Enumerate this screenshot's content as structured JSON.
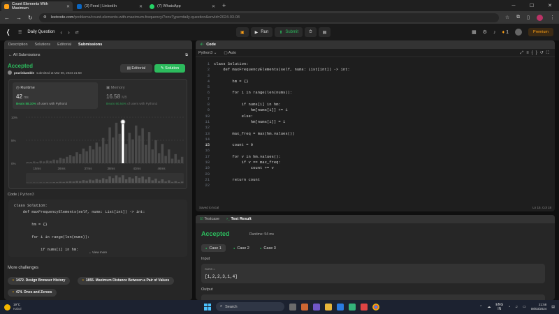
{
  "browser": {
    "tabs": [
      {
        "title": "Count Elements With Maximum",
        "active": true,
        "fav_color": "#ffa116"
      },
      {
        "title": "(3) Feed | LinkedIn",
        "active": false,
        "fav_color": "#0a66c2"
      },
      {
        "title": "(7) WhatsApp",
        "active": false,
        "fav_color": "#25d366"
      }
    ],
    "new_tab": "+",
    "url_host": "leetcode.com",
    "url_path": "/problems/count-elements-with-maximum-frequency/?envType=daily-question&envId=2024-03-08"
  },
  "lc_nav": {
    "daily_label": "Daily Question",
    "run_label": "Run",
    "submit_label": "Submit",
    "streak": "1",
    "premium_label": "Premium"
  },
  "left": {
    "tabs": [
      "Description",
      "Solutions",
      "Editorial",
      "Submissions"
    ],
    "active_tab": "Submissions",
    "back_label": "All Submissions",
    "status": "Accepted",
    "submitter": "pravinkamble",
    "submitted_at": "submitted at Mar 08, 2024 21:58",
    "editorial_btn": "Editorial",
    "solution_btn": "Solution",
    "runtime": {
      "title": "Runtime",
      "value": "42",
      "unit": "ms",
      "beats_label": "Beats",
      "beats_pct": "88.10%",
      "beats_suffix": "of users with Python3"
    },
    "memory": {
      "title": "Memory",
      "value": "16.58",
      "unit": "MB",
      "beats_label": "Beats",
      "beats_pct": "60.54%",
      "beats_suffix": "of users with Python3"
    },
    "code_label": "Code",
    "code_lang": "Python3",
    "code_preview": [
      "class Solution:",
      "    def maxFrequencyElements(self, nums: List[int]) -> int:",
      "",
      "        hm = {}",
      "",
      "        for i in range(len(nums)):",
      "",
      "            if nums[i] in hm:"
    ],
    "view_more": "View more",
    "more_challenges": "More challenges",
    "challenges": [
      "1472. Design Browser History",
      "1855. Maximum Distance Between a Pair of Values",
      "474. Ones and Zeroes"
    ]
  },
  "chart_data": {
    "type": "bar",
    "y_ticks": [
      "10%",
      "5%",
      "0%"
    ],
    "x_ticks": [
      "15ms",
      "26ms",
      "37ms",
      "38ms",
      "43ms",
      "46ms"
    ],
    "highlight_value": 42,
    "values": [
      0.3,
      0.3,
      0.4,
      0.3,
      0.5,
      0.4,
      0.6,
      0.5,
      0.8,
      0.7,
      1.2,
      1.0,
      1.4,
      1.8,
      1.5,
      2.4,
      2.0,
      3.2,
      2.6,
      3.8,
      3.0,
      4.5,
      3.6,
      5.5,
      4.2,
      7.8,
      5.6,
      8.8,
      6.4,
      9.0,
      4.2,
      6.6,
      5.2,
      8.2,
      6.0,
      7.6,
      4.0,
      6.8,
      3.0,
      5.0,
      2.2,
      4.2,
      1.6,
      3.0,
      1.0,
      2.0,
      0.8,
      1.4
    ]
  },
  "editor": {
    "title": "Code",
    "lang": "Python3",
    "auto_label": "Auto",
    "lines": [
      "class Solution:",
      "    def maxFrequencyElements(self, nums: List[int]) -> int:",
      "",
      "        hm = {}",
      "",
      "        for i in range(len(nums)):",
      "",
      "            if nums[i] in hm:",
      "                hm[nums[i]] += 1",
      "            else:",
      "                hm[nums[i]] = 1",
      "",
      "        max_freq = max(hm.values())",
      "",
      "        count = 0",
      "",
      "        for v in hm.values():",
      "            if v == max_freq:",
      "                count += v",
      "",
      "        return count",
      ""
    ],
    "saved": "Saved to local",
    "cursor_pos": "Ln 15, Col 18"
  },
  "test": {
    "tab_case": "Testcase",
    "tab_result": "Test Result",
    "status": "Accepted",
    "runtime": "Runtime: 54 ms",
    "cases": [
      "Case 1",
      "Case 2",
      "Case 3"
    ],
    "input_label": "Input",
    "input_name": "nums =",
    "input_value": "[1,2,2,3,1,4]",
    "output_label": "Output"
  },
  "taskbar": {
    "temp": "19°C",
    "city": "Kabul",
    "search": "Search",
    "lang1": "ENG",
    "lang2": "IN",
    "time": "21:58",
    "date": "08/03/2024"
  }
}
